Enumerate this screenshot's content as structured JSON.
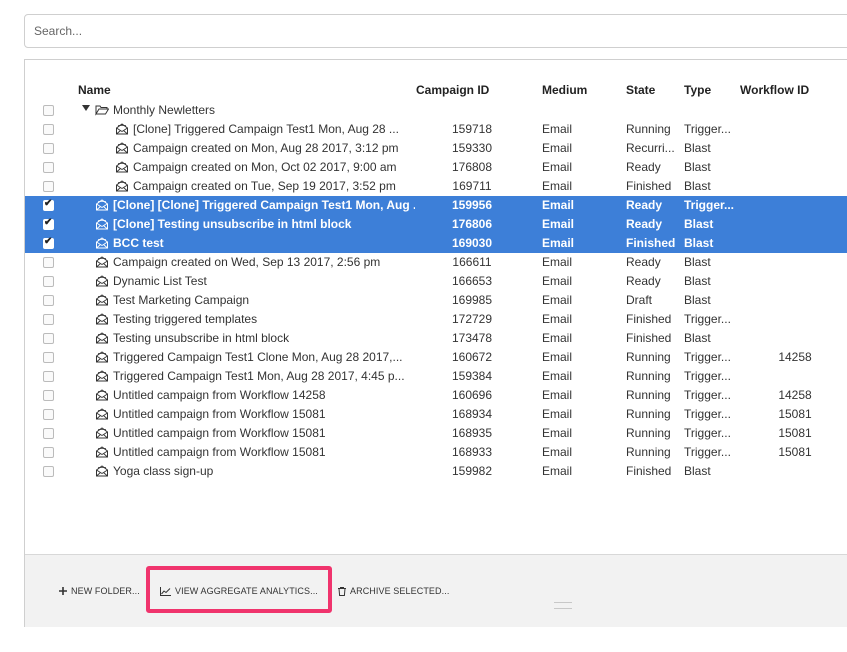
{
  "search": {
    "placeholder": "Search..."
  },
  "columns": {
    "name": "Name",
    "campaign_id": "Campaign ID",
    "medium": "Medium",
    "state": "State",
    "type": "Type",
    "workflow_id": "Workflow ID"
  },
  "folder": {
    "label": "Monthly Newletters",
    "icon": "folder-open-icon",
    "expanded": true
  },
  "rows": [
    {
      "name": "[Clone] Triggered Campaign Test1 Mon, Aug 28 ...",
      "id": "159718",
      "medium": "Email",
      "state": "Running",
      "type": "Trigger...",
      "workflow": "",
      "selected": false,
      "in_folder": true
    },
    {
      "name": "Campaign created on Mon, Aug 28 2017, 3:12 pm",
      "id": "159330",
      "medium": "Email",
      "state": "Recurri...",
      "type": "Blast",
      "workflow": "",
      "selected": false,
      "in_folder": true
    },
    {
      "name": "Campaign created on Mon, Oct 02 2017, 9:00 am",
      "id": "176808",
      "medium": "Email",
      "state": "Ready",
      "type": "Blast",
      "workflow": "",
      "selected": false,
      "in_folder": true
    },
    {
      "name": "Campaign created on Tue, Sep 19 2017, 3:52 pm",
      "id": "169711",
      "medium": "Email",
      "state": "Finished",
      "type": "Blast",
      "workflow": "",
      "selected": false,
      "in_folder": true
    },
    {
      "name": "[Clone] [Clone] Triggered Campaign Test1 Mon, Aug ...",
      "id": "159956",
      "medium": "Email",
      "state": "Ready",
      "type": "Trigger...",
      "workflow": "",
      "selected": true,
      "in_folder": false
    },
    {
      "name": "[Clone] Testing unsubscribe in html block",
      "id": "176806",
      "medium": "Email",
      "state": "Ready",
      "type": "Blast",
      "workflow": "",
      "selected": true,
      "in_folder": false
    },
    {
      "name": "BCC test",
      "id": "169030",
      "medium": "Email",
      "state": "Finished",
      "type": "Blast",
      "workflow": "",
      "selected": true,
      "in_folder": false
    },
    {
      "name": "Campaign created on Wed, Sep 13 2017, 2:56 pm",
      "id": "166611",
      "medium": "Email",
      "state": "Ready",
      "type": "Blast",
      "workflow": "",
      "selected": false,
      "in_folder": false
    },
    {
      "name": "Dynamic List Test",
      "id": "166653",
      "medium": "Email",
      "state": "Ready",
      "type": "Blast",
      "workflow": "",
      "selected": false,
      "in_folder": false
    },
    {
      "name": "Test Marketing Campaign",
      "id": "169985",
      "medium": "Email",
      "state": "Draft",
      "type": "Blast",
      "workflow": "",
      "selected": false,
      "in_folder": false
    },
    {
      "name": "Testing triggered templates",
      "id": "172729",
      "medium": "Email",
      "state": "Finished",
      "type": "Trigger...",
      "workflow": "",
      "selected": false,
      "in_folder": false
    },
    {
      "name": "Testing unsubscribe in html block",
      "id": "173478",
      "medium": "Email",
      "state": "Finished",
      "type": "Blast",
      "workflow": "",
      "selected": false,
      "in_folder": false
    },
    {
      "name": "Triggered Campaign Test1 Clone Mon, Aug 28 2017,...",
      "id": "160672",
      "medium": "Email",
      "state": "Running",
      "type": "Trigger...",
      "workflow": "14258",
      "selected": false,
      "in_folder": false
    },
    {
      "name": "Triggered Campaign Test1 Mon, Aug 28 2017, 4:45 p...",
      "id": "159384",
      "medium": "Email",
      "state": "Running",
      "type": "Trigger...",
      "workflow": "",
      "selected": false,
      "in_folder": false
    },
    {
      "name": "Untitled campaign from Workflow 14258",
      "id": "160696",
      "medium": "Email",
      "state": "Running",
      "type": "Trigger...",
      "workflow": "14258",
      "selected": false,
      "in_folder": false
    },
    {
      "name": "Untitled campaign from Workflow 15081",
      "id": "168934",
      "medium": "Email",
      "state": "Running",
      "type": "Trigger...",
      "workflow": "15081",
      "selected": false,
      "in_folder": false
    },
    {
      "name": "Untitled campaign from Workflow 15081",
      "id": "168935",
      "medium": "Email",
      "state": "Running",
      "type": "Trigger...",
      "workflow": "15081",
      "selected": false,
      "in_folder": false
    },
    {
      "name": "Untitled campaign from Workflow 15081",
      "id": "168933",
      "medium": "Email",
      "state": "Running",
      "type": "Trigger...",
      "workflow": "15081",
      "selected": false,
      "in_folder": false
    },
    {
      "name": "Yoga class sign-up",
      "id": "159982",
      "medium": "Email",
      "state": "Finished",
      "type": "Blast",
      "workflow": "",
      "selected": false,
      "in_folder": false
    }
  ],
  "footer": {
    "new_folder": "NEW FOLDER...",
    "view_analytics": "VIEW AGGREGATE ANALYTICS...",
    "archive_selected": "ARCHIVE SELECTED..."
  },
  "colors": {
    "selection": "#3d7fd8",
    "highlight": "#f0346d"
  }
}
